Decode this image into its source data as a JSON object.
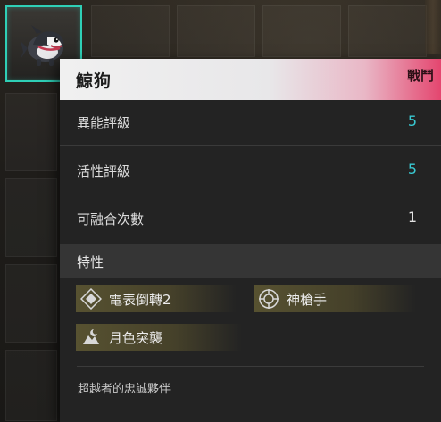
{
  "pet": {
    "name": "鯨狗",
    "type_tag": "戰鬥"
  },
  "stats": [
    {
      "label": "異能評級",
      "value": "5",
      "color": "#39c9d2"
    },
    {
      "label": "活性評級",
      "value": "5",
      "color": "#39c9d2"
    },
    {
      "label": "可融合次數",
      "value": "1",
      "color": "#e2e2e2"
    }
  ],
  "traits_section": {
    "title": "特性",
    "items": [
      {
        "label": "電表倒轉2",
        "icon": "diamond-icon"
      },
      {
        "label": "神槍手",
        "icon": "crosshair-icon"
      },
      {
        "label": "月色突襲",
        "icon": "moon-strike-icon"
      }
    ]
  },
  "description": "超越者的忠誠夥伴",
  "colors": {
    "selection_border": "#2fcfb6",
    "header_accent": "#e4466f",
    "stat_highlight": "#39c9d2"
  }
}
